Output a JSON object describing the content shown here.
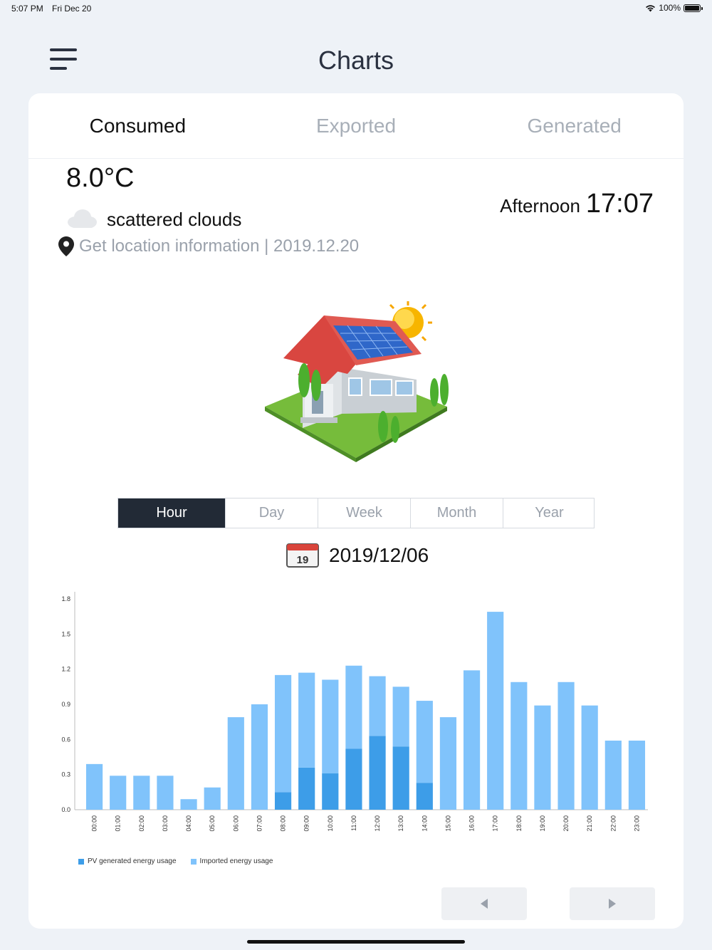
{
  "status": {
    "time": "5:07 PM",
    "date": "Fri Dec 20",
    "battery": "100%"
  },
  "header": {
    "title": "Charts"
  },
  "tabs": [
    {
      "label": "Consumed",
      "active": true
    },
    {
      "label": "Exported",
      "active": false
    },
    {
      "label": "Generated",
      "active": false
    }
  ],
  "weather": {
    "temperature": "8.0°C",
    "description": "scattered clouds",
    "location": "Get location information | 2019.12.20",
    "period": "Afternoon",
    "time": "17:07"
  },
  "range_tabs": [
    {
      "label": "Hour",
      "active": true
    },
    {
      "label": "Day",
      "active": false
    },
    {
      "label": "Week",
      "active": false
    },
    {
      "label": "Month",
      "active": false
    },
    {
      "label": "Year",
      "active": false
    }
  ],
  "date_picker": {
    "calendar_day": "19",
    "date": "2019/12/06"
  },
  "colors": {
    "pv": "#3d9de8",
    "imported": "#80c3fb",
    "active_tab_bg": "#222a36"
  },
  "chart_data": {
    "type": "bar",
    "stacked": true,
    "categories": [
      "00:00",
      "01:00",
      "02:00",
      "03:00",
      "04:00",
      "05:00",
      "06:00",
      "07:00",
      "08:00",
      "09:00",
      "10:00",
      "11:00",
      "12:00",
      "13:00",
      "14:00",
      "15:00",
      "16:00",
      "17:00",
      "18:00",
      "19:00",
      "20:00",
      "21:00",
      "22:00",
      "23:00"
    ],
    "series": [
      {
        "name": "PV generated energy usage",
        "color": "#3d9de8",
        "values": [
          0,
          0,
          0,
          0,
          0,
          0,
          0,
          0,
          0.15,
          0.36,
          0.31,
          0.52,
          0.63,
          0.54,
          0.23,
          0,
          0,
          0,
          0,
          0,
          0,
          0,
          0,
          0
        ]
      },
      {
        "name": "Imported energy usage",
        "color": "#80c3fb",
        "values": [
          0.39,
          0.29,
          0.29,
          0.29,
          0.09,
          0.19,
          0.79,
          0.9,
          1.0,
          0.81,
          0.8,
          0.71,
          0.51,
          0.51,
          0.7,
          0.79,
          1.19,
          1.69,
          1.09,
          0.89,
          1.09,
          0.89,
          0.59,
          0.59
        ]
      }
    ],
    "yticks": [
      "0.0",
      "0.3",
      "0.6",
      "0.9",
      "1.2",
      "1.5",
      "1.8"
    ],
    "ylim": [
      0,
      1.8
    ],
    "legend_position": "bottom-left"
  }
}
